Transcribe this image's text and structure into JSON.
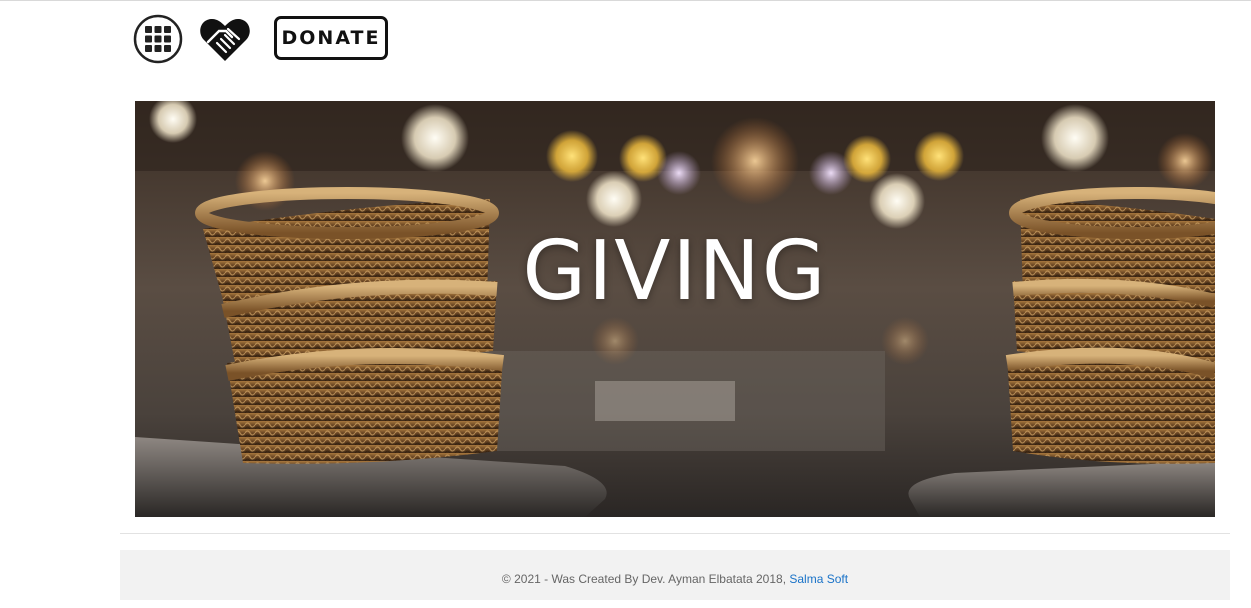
{
  "toolbar": {
    "grid_icon": "grid-icon",
    "heart_icon": "heart-handshake-icon",
    "donate_label": "DONATE"
  },
  "banner": {
    "title": "GIVING"
  },
  "footer": {
    "copyright_text": "© 2021 - Was Created By Dev. Ayman Elbatata 2018, ",
    "link_label": "Salma Soft",
    "link_color": "#1a73c8"
  }
}
